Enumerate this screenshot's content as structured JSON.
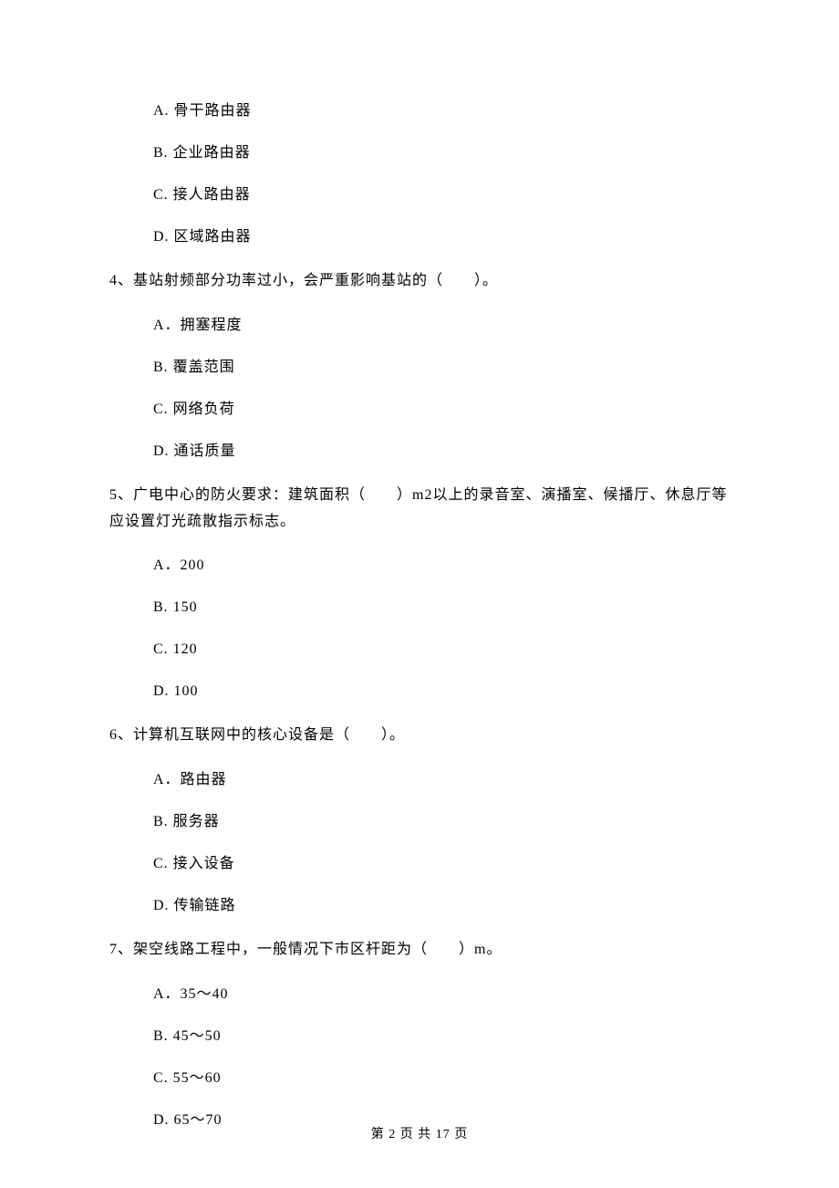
{
  "q3": {
    "options": {
      "a": "A. 骨干路由器",
      "b": "B. 企业路由器",
      "c": "C. 接人路由器",
      "d": "D. 区域路由器"
    }
  },
  "q4": {
    "text": "4、基站射频部分功率过小，会严重影响基站的（　　）。",
    "options": {
      "a": "A．拥塞程度",
      "b": "B. 覆盖范围",
      "c": "C. 网络负荷",
      "d": "D. 通话质量"
    }
  },
  "q5": {
    "text": "5、广电中心的防火要求：建筑面积（　　）m2以上的录音室、演播室、候播厅、休息厅等应设置灯光疏散指示标志。",
    "options": {
      "a": "A．200",
      "b": "B. 150",
      "c": "C. 120",
      "d": "D. 100"
    }
  },
  "q6": {
    "text": "6、计算机互联网中的核心设备是（　　）。",
    "options": {
      "a": "A．路由器",
      "b": "B. 服务器",
      "c": "C. 接入设备",
      "d": "D. 传输链路"
    }
  },
  "q7": {
    "text": "7、架空线路工程中，一般情况下市区杆距为（　　）m。",
    "options": {
      "a": "A．35～40",
      "b": "B. 45～50",
      "c": "C. 55～60",
      "d": "D. 65～70"
    }
  },
  "footer": "第 2 页 共 17 页"
}
